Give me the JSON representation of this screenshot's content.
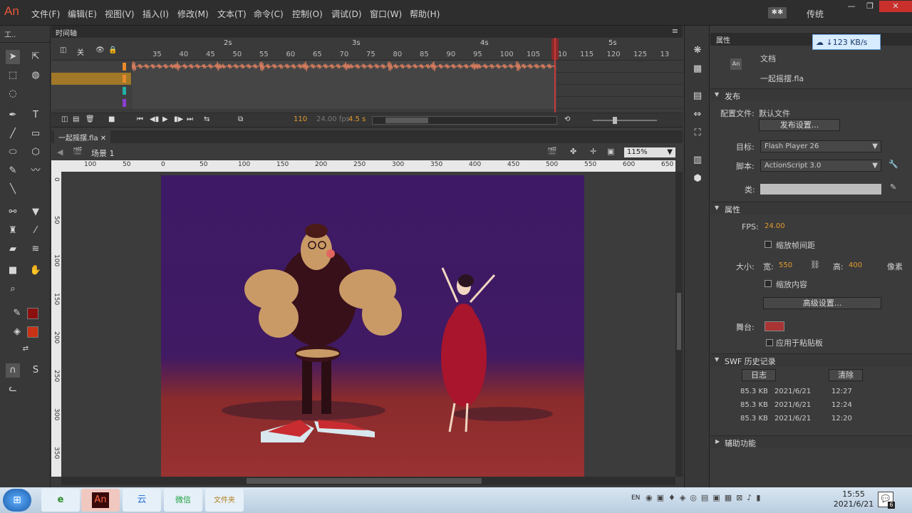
{
  "app": {
    "logo": "An",
    "workspace": "传统"
  },
  "menu": [
    "文件(F)",
    "编辑(E)",
    "视图(V)",
    "插入(I)",
    "修改(M)",
    "文本(T)",
    "命令(C)",
    "控制(O)",
    "调试(D)",
    "窗口(W)",
    "帮助(H)"
  ],
  "tools": {
    "header": "工.."
  },
  "timeline": {
    "tab": "时间轴",
    "seconds": [
      "2s",
      "3s",
      "4s",
      "5s"
    ],
    "frame_numbers": [
      "35",
      "40",
      "45",
      "50",
      "55",
      "60",
      "65",
      "70",
      "75",
      "80",
      "85",
      "90",
      "95",
      "100",
      "105",
      "110",
      "115",
      "120",
      "125",
      "13"
    ],
    "header_label": "关",
    "layer_colors": [
      "#e8892c",
      "#e8892c",
      "#22b0a8",
      "#8a3fd0",
      "#20d0e0"
    ],
    "current_frame": "110",
    "fps": "24.00 fps",
    "time": "4.5 s"
  },
  "document": {
    "tab": "一起摇摆.fla",
    "scene": "场景 1",
    "zoom": "115%"
  },
  "rulers": {
    "h": [
      "100",
      "50",
      "0",
      "50",
      "100",
      "150",
      "200",
      "250",
      "300",
      "350",
      "400",
      "450",
      "500",
      "550",
      "600",
      "650"
    ],
    "v": [
      "0",
      "50",
      "100",
      "150",
      "200",
      "250",
      "300",
      "350"
    ]
  },
  "properties": {
    "tab": "属性",
    "doc_type": "文档",
    "doc_icon": "An",
    "filename": "一起摇摆.fla",
    "publish_section": "发布",
    "profile_label": "配置文件:",
    "profile_value": "默认文件",
    "publish_settings": "发布设置...",
    "target_label": "目标:",
    "target_value": "Flash Player 26",
    "script_label": "脚本:",
    "script_value": "ActionScript 3.0",
    "class_label": "类:",
    "props_section": "属性",
    "fps_label": "FPS:",
    "fps_value": "24.00",
    "scale_spans": "缩放帧间距",
    "size_label": "大小:",
    "width_label": "宽:",
    "width_value": "550",
    "height_label": "高:",
    "height_value": "400",
    "unit": "像素",
    "scale_content": "缩放内容",
    "advanced": "高级设置...",
    "stage_label": "舞台:",
    "stage_color": "#a83434",
    "apply_paste": "应用于粘贴板",
    "swf_section": "SWF 历史记录",
    "log_btn": "日志",
    "clear_btn": "清除",
    "history": [
      {
        "size": "85.3 KB",
        "date": "2021/6/21",
        "time": "12:27"
      },
      {
        "size": "85.3 KB",
        "date": "2021/6/21",
        "time": "12:24"
      },
      {
        "size": "85.3 KB",
        "date": "2021/6/21",
        "time": "12:20"
      }
    ],
    "accessibility_section": "辅助功能"
  },
  "network": {
    "speed": "↓123 KB/s"
  },
  "taskbar": {
    "apps": [
      "e",
      "An",
      "云",
      "微信",
      "文件夹"
    ],
    "tray": [
      "EN"
    ],
    "time": "15:55",
    "date": "2021/6/21",
    "notifications": "6"
  }
}
